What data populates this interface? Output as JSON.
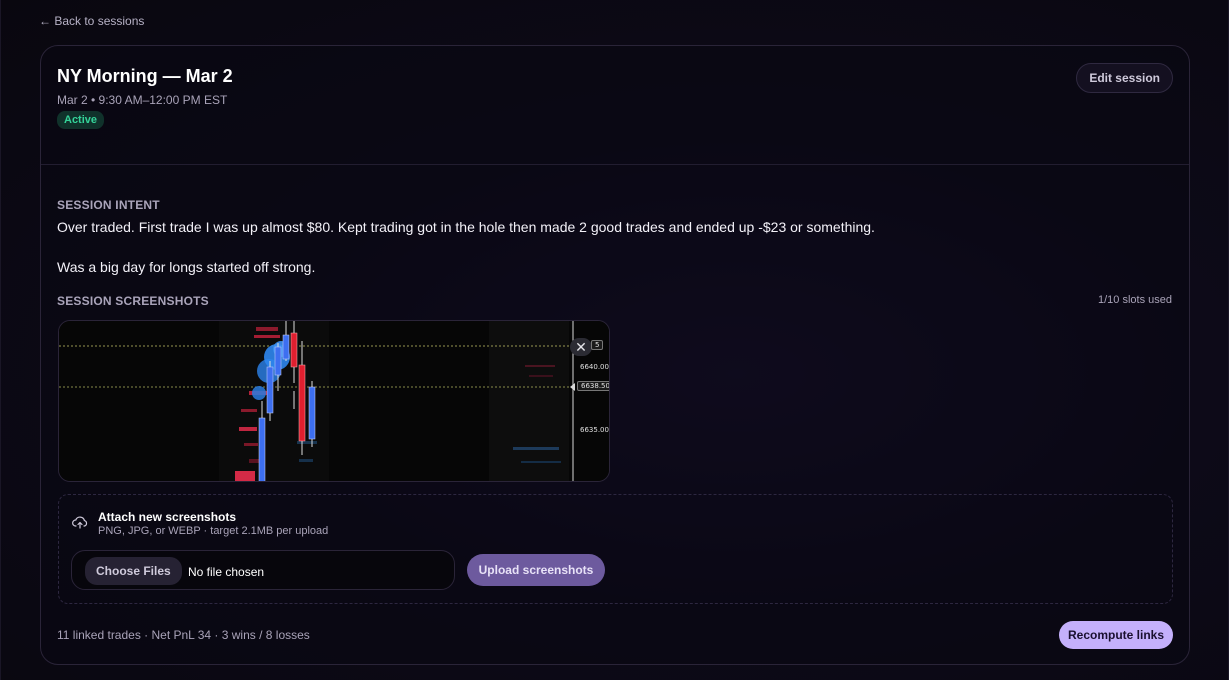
{
  "nav": {
    "back_label": "← Back to sessions"
  },
  "session": {
    "title": "NY Morning — Mar 2",
    "subtitle": "Mar 2 • 9:30 AM–12:00 PM EST",
    "status": "Active",
    "status_color": "#34d399",
    "edit_label": "Edit session"
  },
  "intent": {
    "label": "SESSION INTENT",
    "paragraphs": [
      "Over traded. First trade I was up almost $80. Kept trading got in the hole then made 2 good trades and ended up -$23 or something.",
      "Was a big day for longs started off strong."
    ]
  },
  "screenshots": {
    "label": "SESSION SCREENSHOTS",
    "slots_used": "1/10 slots used",
    "close_glyph": "✕",
    "price_labels": [
      "5",
      "6640.00",
      "6638.50",
      "6635.00"
    ]
  },
  "upload": {
    "icon": "cloud-upload-icon",
    "title": "Attach new screenshots",
    "hint": "PNG, JPG, or WEBP · target 2.1MB per upload",
    "choose_label": "Choose Files",
    "no_file_label": "No file chosen",
    "upload_label": "Upload screenshots",
    "accent": "#6d5a9e"
  },
  "footer": {
    "stats": "11 linked trades · Net PnL 34 · 3 wins / 8 losses",
    "recompute_label": "Recompute links",
    "recompute_color": "#c4b0fb"
  }
}
